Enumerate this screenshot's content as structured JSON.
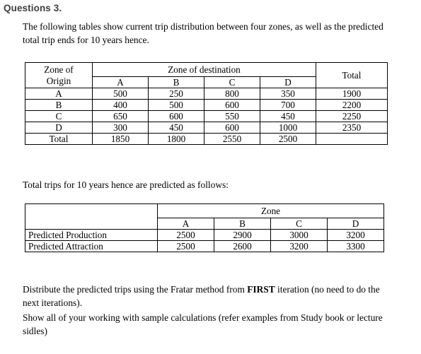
{
  "heading": "Questions 3.",
  "intro_paragraph": "The following tables show current trip distribution between four zones, as well as the predicted total trip ends for 10 years hence.",
  "second_paragraph": "Total trips for 10 years hence are predicted as follows:",
  "task_paragraph_part1": "Distribute the predicted trips using the Fratar method from ",
  "task_paragraph_emphasis": "FIRST",
  "task_paragraph_part2": " iteration (no need to do the next iterations).",
  "show_working_paragraph": "Show all of your working with sample calculations (refer examples from Study book or lecture sidles)",
  "trip_distribution_table": {
    "origin_header_line1": "Zone of",
    "origin_header_line2": "Origin",
    "destination_header": "Zone of destination",
    "total_header": "Total",
    "zone_columns": [
      "A",
      "B",
      "C",
      "D"
    ],
    "rows": [
      {
        "origin": "A",
        "values": [
          "500",
          "250",
          "800",
          "350"
        ],
        "total": "1900"
      },
      {
        "origin": "B",
        "values": [
          "400",
          "500",
          "600",
          "700"
        ],
        "total": "2200"
      },
      {
        "origin": "C",
        "values": [
          "650",
          "600",
          "550",
          "450"
        ],
        "total": "2250"
      },
      {
        "origin": "D",
        "values": [
          "300",
          "450",
          "600",
          "1000"
        ],
        "total": "2350"
      }
    ],
    "total_row": {
      "origin": "Total",
      "values": [
        "1850",
        "1800",
        "2550",
        "2500"
      ],
      "total": ""
    }
  },
  "predicted_trips_table": {
    "corner_header": "",
    "zone_header": "Zone",
    "zone_columns": [
      "A",
      "B",
      "C",
      "D"
    ],
    "rows": [
      {
        "label": "Predicted Production",
        "values": [
          "2500",
          "2900",
          "3000",
          "3200"
        ]
      },
      {
        "label": "Predicted Attraction",
        "values": [
          "2500",
          "2600",
          "3200",
          "3300"
        ]
      }
    ]
  }
}
